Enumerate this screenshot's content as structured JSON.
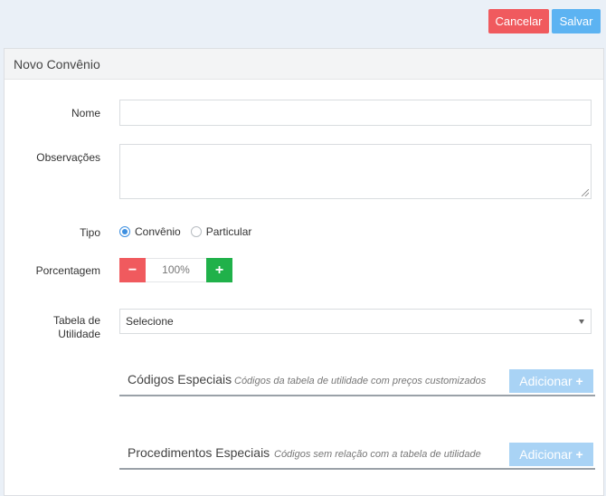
{
  "topbar": {
    "cancel_label": "Cancelar",
    "save_label": "Salvar"
  },
  "panel": {
    "title": "Novo Convênio"
  },
  "form": {
    "nome_label": "Nome",
    "nome_value": "",
    "observacoes_label": "Observações",
    "observacoes_value": "",
    "tipo_label": "Tipo",
    "tipo_options": [
      "Convênio",
      "Particular"
    ],
    "tipo_selected": "Convênio",
    "porcentagem_label": "Porcentagem",
    "porcentagem_minus": "−",
    "porcentagem_value": "100%",
    "porcentagem_plus": "+",
    "tabela_label_line1": "Tabela de",
    "tabela_label_line2": "Utilidade",
    "tabela_selected": "Selecione"
  },
  "sections": [
    {
      "title": "Códigos Especiais",
      "subtitle": "Códigos da tabela de utilidade com preços customizados",
      "add_label": "Adicionar",
      "add_icon": "+"
    },
    {
      "title": "Procedimentos Especiais",
      "subtitle": "Códigos sem relação com a tabela de utilidade",
      "add_label": "Adicionar",
      "add_icon": "+"
    }
  ],
  "colors": {
    "danger": "#f05a5e",
    "primary": "#5cb3f2",
    "success": "#20b14a",
    "accent": "#3d8fe0"
  }
}
